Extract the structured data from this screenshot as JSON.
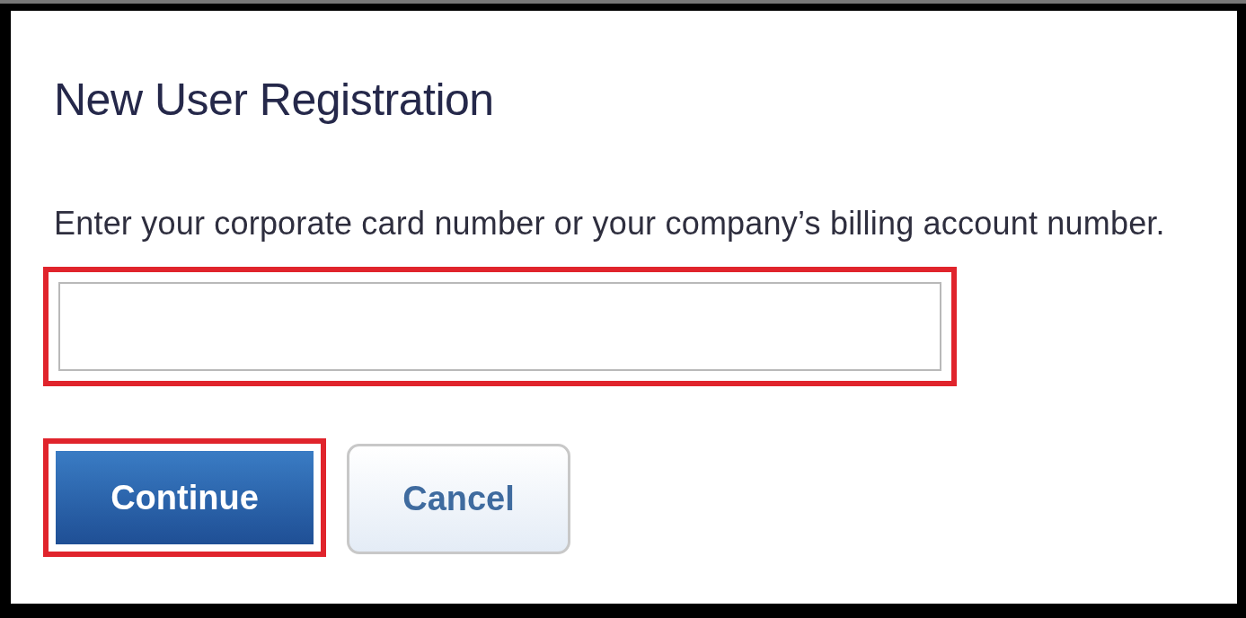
{
  "title": "New User Registration",
  "instruction": "Enter your corporate card number or your company’s billing account number.",
  "account_field": {
    "highlighted": true
  },
  "buttons": [
    {
      "label": "Continue",
      "kind": "primary",
      "highlighted": true
    },
    {
      "label": "Cancel",
      "kind": "secondary",
      "highlighted": false
    }
  ]
}
